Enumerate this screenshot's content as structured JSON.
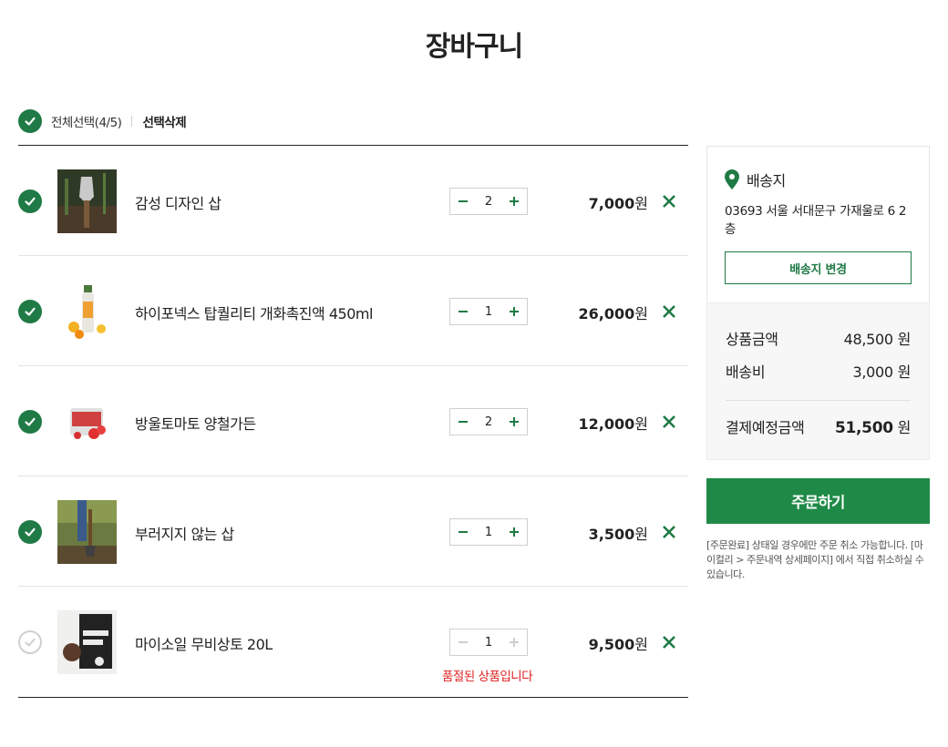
{
  "page": {
    "title": "장바구니"
  },
  "select_bar": {
    "select_all_label": "전체선택(4/5)",
    "delete_selected_label": "선택삭제"
  },
  "items": [
    {
      "name": "감성 디자인 삽",
      "qty": "2",
      "price": "7,000",
      "unit": "원",
      "checked": true,
      "sold_out": false
    },
    {
      "name": "하이포넥스 탑퀄리티 개화촉진액 450ml",
      "qty": "1",
      "price": "26,000",
      "unit": "원",
      "checked": true,
      "sold_out": false
    },
    {
      "name": "방울토마토 양철가든",
      "qty": "2",
      "price": "12,000",
      "unit": "원",
      "checked": true,
      "sold_out": false
    },
    {
      "name": "부러지지 않는 삽",
      "qty": "1",
      "price": "3,500",
      "unit": "원",
      "checked": true,
      "sold_out": false
    },
    {
      "name": "마이소일 무비상토 20L",
      "qty": "1",
      "price": "9,500",
      "unit": "원",
      "checked": false,
      "sold_out": true,
      "sold_out_text": "품절된 상품입니다"
    }
  ],
  "shipping": {
    "title": "배송지",
    "address": "03693 서울 서대문구 가재울로 6 2층",
    "change_button": "배송지 변경"
  },
  "summary": {
    "subtotal_label": "상품금액",
    "subtotal_value": "48,500 원",
    "shipping_label": "배송비",
    "shipping_value": "3,000 원",
    "total_label": "결제예정금액",
    "total_value": "51,500",
    "total_unit": " 원"
  },
  "order_button": "주문하기",
  "notice": "[주문완료] 상태일 경우에만 주문 취소 가능합니다. [마이컬리 > 주문내역 상세페이지] 에서 직접 취소하실 수 있습니다.",
  "colors": {
    "accent": "#1f7a45",
    "order_button": "#1f8a47",
    "soldout": "#e02020"
  },
  "icons": {
    "check": "check-icon",
    "minus": "minus-icon",
    "plus": "plus-icon",
    "remove": "close-icon",
    "pin": "location-pin-icon"
  }
}
